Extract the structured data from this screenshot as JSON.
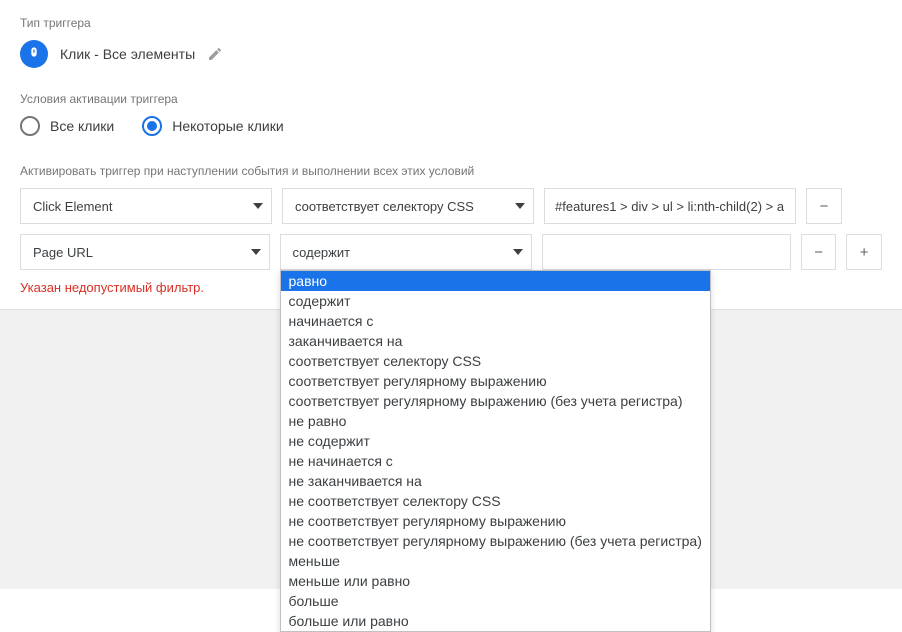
{
  "labels": {
    "trigger_type": "Тип триггера",
    "activation_conditions": "Условия активации триггера",
    "conditions_hint": "Активировать триггер при наступлении события и выполнении всех этих условий"
  },
  "trigger": {
    "type_name": "Клик - Все элементы"
  },
  "activation": {
    "all_clicks": "Все клики",
    "some_clicks": "Некоторые клики"
  },
  "conditions": [
    {
      "variable": "Click Element",
      "operator": "соответствует селектору CSS",
      "value": "#features1 > div > ul > li:nth-child(2) > a"
    },
    {
      "variable": "Page URL",
      "operator": "содержит",
      "value": ""
    }
  ],
  "error": "Указан недопустимый фильтр.",
  "buttons": {
    "minus": "−",
    "plus": "+"
  },
  "operator_options": [
    "равно",
    "содержит",
    "начинается с",
    "заканчивается на",
    "соответствует селектору CSS",
    "соответствует регулярному выражению",
    "соответствует регулярному выражению (без учета регистра)",
    "не равно",
    "не содержит",
    "не начинается с",
    "не заканчивается на",
    "не соответствует селектору CSS",
    "не соответствует регулярному выражению",
    "не соответствует регулярному выражению (без учета регистра)",
    "меньше",
    "меньше или равно",
    "больше",
    "больше или равно"
  ]
}
